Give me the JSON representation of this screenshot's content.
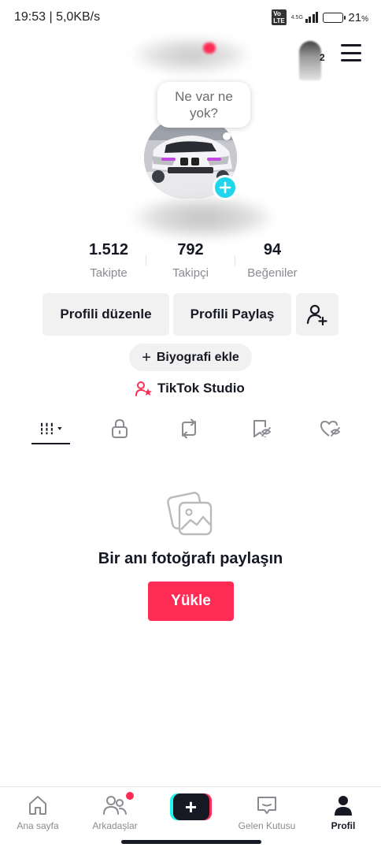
{
  "status_bar": {
    "time_speed": "19:53 | 5,0KB/s",
    "volte": "Vo LTE",
    "network": "4.5G",
    "battery_percent": "21",
    "battery_unit": "%",
    "battery_level": 0.21
  },
  "header": {
    "notification_count": "2"
  },
  "profile": {
    "note": "Ne var ne yok?"
  },
  "stats": [
    {
      "value": "1.512",
      "label": "Takipte"
    },
    {
      "value": "792",
      "label": "Takipçi"
    },
    {
      "value": "94",
      "label": "Beğeniler"
    }
  ],
  "buttons": {
    "edit_profile": "Profili düzenle",
    "share_profile": "Profili Paylaş",
    "add_bio": "Biyografi ekle",
    "add_bio_plus": "+",
    "studio": "TikTok Studio"
  },
  "tabs": [
    {
      "icon": "grid-icon",
      "active": true
    },
    {
      "icon": "lock-icon",
      "active": false
    },
    {
      "icon": "repost-icon",
      "active": false
    },
    {
      "icon": "bookmark-hidden-icon",
      "active": false
    },
    {
      "icon": "liked-hidden-icon",
      "active": false
    }
  ],
  "empty_state": {
    "icon": "photos-icon",
    "title": "Bir anı fotoğrafı paylaşın",
    "upload_label": "Yükle"
  },
  "bottom_nav": {
    "home": "Ana sayfa",
    "friends": "Arkadaşlar",
    "inbox": "Gelen Kutusu",
    "profile": "Profil",
    "create_symbol": "+"
  },
  "colors": {
    "accent": "#fe2c55",
    "cyan": "#20d5ec",
    "text": "#161823",
    "muted": "#8a8b91",
    "button_bg": "#f1f1f2"
  }
}
